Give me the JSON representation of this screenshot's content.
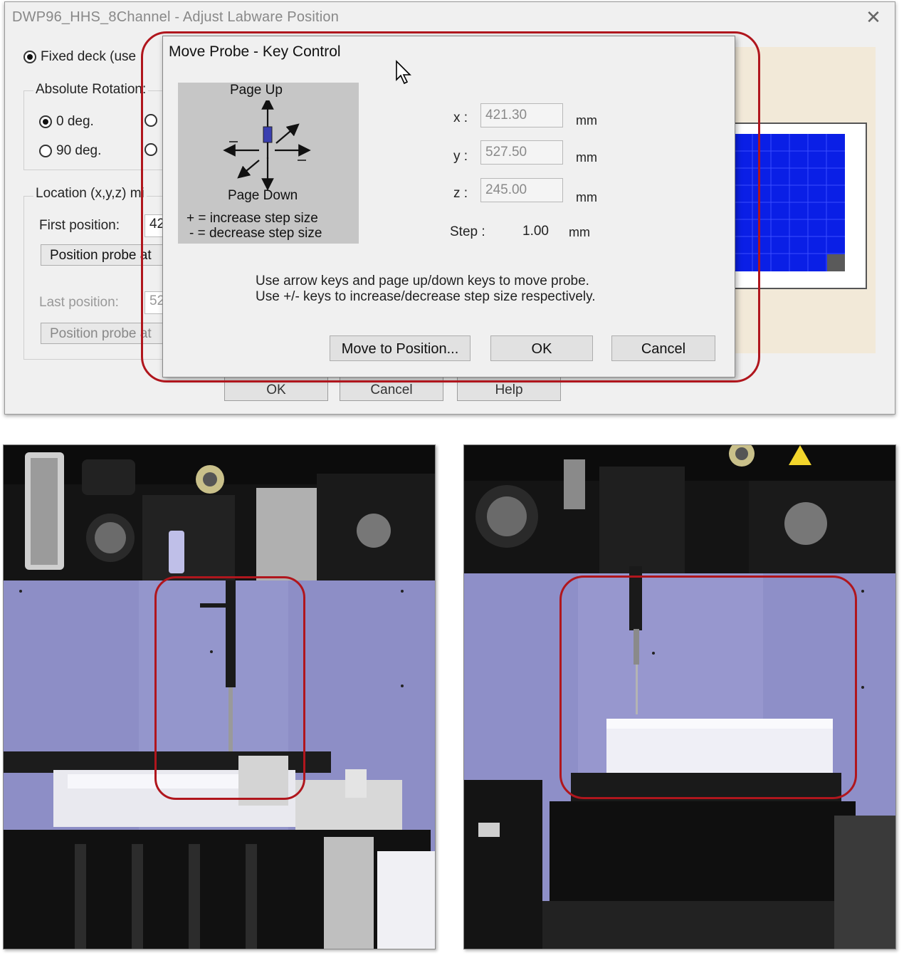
{
  "window": {
    "title": "DWP96_HHS_8Channel - Adjust Labware Position",
    "close_glyph": "✕",
    "fixed_deck_label": "Fixed deck (use",
    "absolute_rotation_label": "Absolute Rotation:",
    "rotation_options": [
      "0 deg.",
      "90 deg."
    ],
    "location_label": "Location (x,y,z) mi",
    "first_position_label": "First position:",
    "first_position_value": "42",
    "position_probe_button": "Position probe at",
    "last_position_label": "Last position:",
    "last_position_value": "52",
    "bottom_buttons": [
      "OK",
      "Cancel",
      "Help"
    ]
  },
  "dialog": {
    "title": "Move Probe - Key Control",
    "keypad": {
      "page_up": "Page Up",
      "page_down": "Page Down",
      "increase_hint": "+ = increase step size",
      "decrease_hint": "- = decrease step size"
    },
    "coords": {
      "x_label": "x :",
      "x_value": "421.30",
      "y_label": "y :",
      "y_value": "527.50",
      "z_label": "z :",
      "z_value": "245.00",
      "unit": "mm"
    },
    "step": {
      "label": "Step :",
      "value": "1.00",
      "unit": "mm"
    },
    "instructions": [
      "Use arrow keys and page up/down keys to move probe.",
      "Use +/- keys to increase/decrease step size respectively."
    ],
    "buttons": {
      "move": "Move to Position...",
      "ok": "OK",
      "cancel": "Cancel"
    }
  },
  "colors": {
    "highlight": "#b0161d",
    "plate_well": "#0a1fe6",
    "cream_panel": "#f2e9d8"
  },
  "icons": [
    "radio-button",
    "mouse-cursor-icon",
    "arrow-up-icon",
    "arrow-down-icon",
    "arrow-left-icon",
    "arrow-right-icon",
    "warning-icon"
  ]
}
